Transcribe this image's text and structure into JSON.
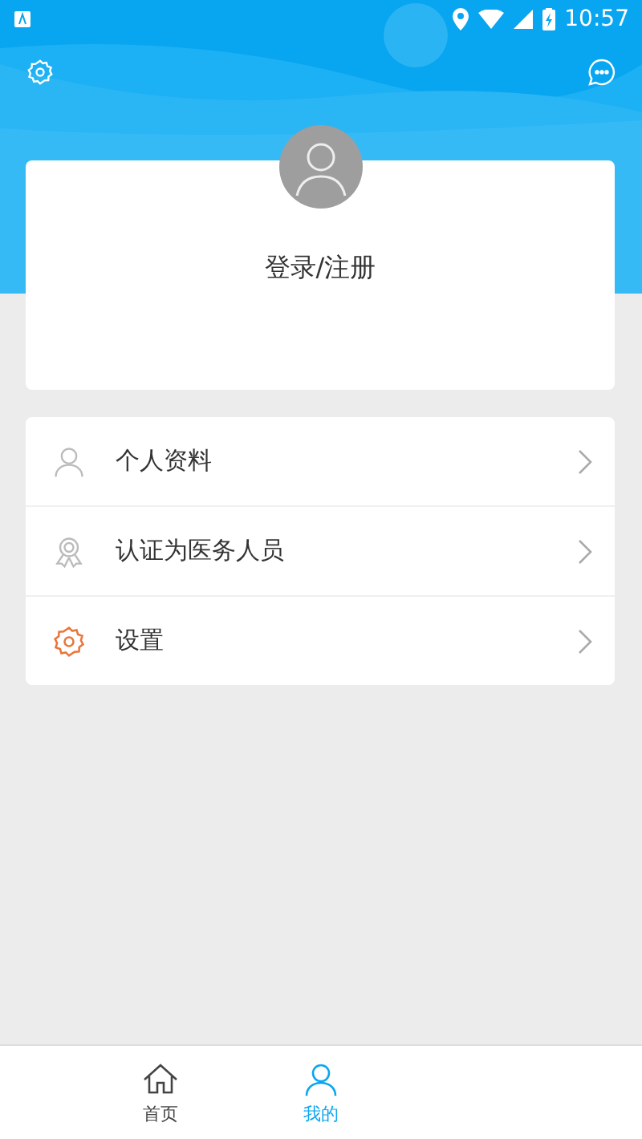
{
  "status_bar": {
    "time": "10:57"
  },
  "profile": {
    "login_label": "登录/注册"
  },
  "menu": [
    {
      "kind": "person",
      "label": "个人资料"
    },
    {
      "kind": "badge",
      "label": "认证为医务人员"
    },
    {
      "kind": "gear",
      "label": "设置"
    }
  ],
  "bottom_nav": [
    {
      "kind": "home",
      "label": "首页",
      "selected": false
    },
    {
      "kind": "user",
      "label": "我的",
      "selected": true
    }
  ]
}
